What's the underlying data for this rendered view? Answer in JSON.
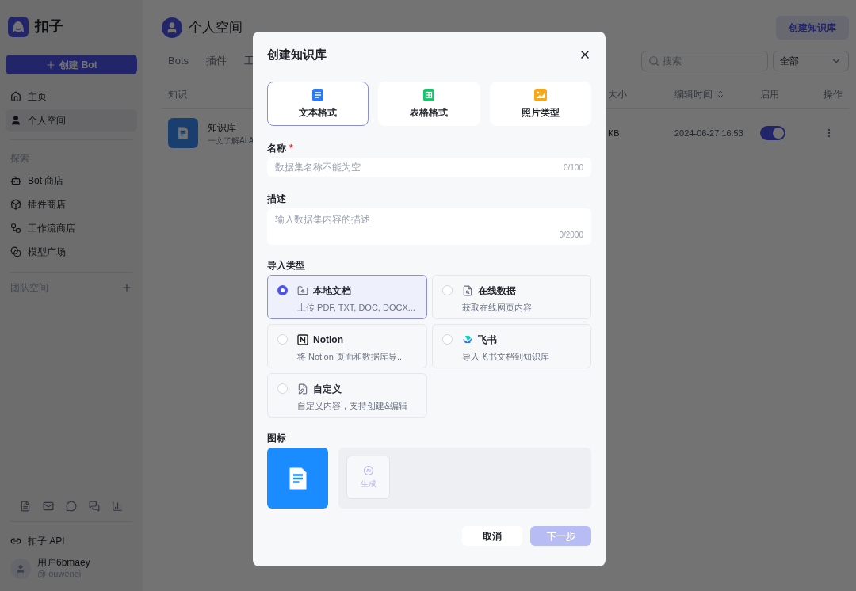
{
  "sidebar": {
    "logo": "扣子",
    "create_button": "创建 Bot",
    "nav": [
      {
        "label": "主页",
        "kind": "home",
        "selected": false
      },
      {
        "label": "个人空间",
        "kind": "person",
        "selected": true
      }
    ],
    "explore_title": "探索",
    "explore": [
      {
        "label": "Bot 商店",
        "kind": "bot"
      },
      {
        "label": "插件商店",
        "kind": "plugin"
      },
      {
        "label": "工作流商店",
        "kind": "workflow"
      },
      {
        "label": "模型广场",
        "kind": "model"
      }
    ],
    "team_title": "团队空间",
    "api_link": "扣子 API",
    "user": {
      "name": "用户6bmaey",
      "handle": "@ ouwenqi"
    }
  },
  "main": {
    "title": "个人空间",
    "create_button": "创建知识库",
    "tabs": [
      "Bots",
      "插件",
      "工"
    ],
    "search": {
      "placeholder": "搜索"
    },
    "filter": "全部",
    "columns": [
      "知识",
      "大小",
      "编辑时间",
      "启用",
      "操作"
    ],
    "rows": [
      {
        "name": "知识库",
        "desc": "一文了解AI A",
        "size": "KB",
        "time": "2024-06-27 16:53",
        "enabled": true
      }
    ]
  },
  "dialog": {
    "title": "创建知识库",
    "formats": [
      {
        "label": "文本格式",
        "kind": "text",
        "selected": true
      },
      {
        "label": "表格格式",
        "kind": "table",
        "selected": false
      },
      {
        "label": "照片类型",
        "kind": "image",
        "selected": false
      }
    ],
    "name_label": "名称",
    "name_required": true,
    "required_mark": "*",
    "name_placeholder": "数据集名称不能为空",
    "name_count": "0/100",
    "desc_label": "描述",
    "desc_placeholder": "输入数据集内容的描述",
    "desc_count": "0/2000",
    "import_label": "导入类型",
    "imports": [
      {
        "title": "本地文档",
        "desc": "上传 PDF, TXT, DOC, DOCX...",
        "kind": "local",
        "selected": true
      },
      {
        "title": "在线数据",
        "desc": "获取在线网页内容",
        "kind": "online",
        "selected": false
      },
      {
        "title": "Notion",
        "desc": "将 Notion 页面和数据库导...",
        "kind": "notion",
        "selected": false
      },
      {
        "title": "飞书",
        "desc": "导入飞书文档到知识库",
        "kind": "feishu",
        "selected": false
      },
      {
        "title": "自定义",
        "desc": "自定义内容，支持创建&编辑",
        "kind": "custom",
        "selected": false
      }
    ],
    "icon_label": "图标",
    "generate_label": "生成",
    "cancel": "取消",
    "next": "下一步"
  }
}
